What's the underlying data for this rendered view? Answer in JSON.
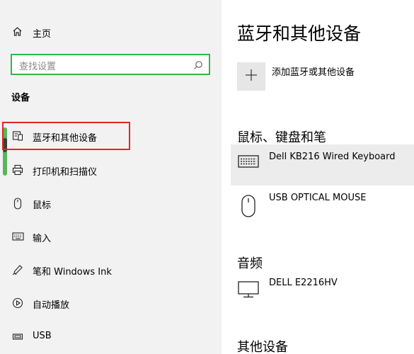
{
  "sidebar": {
    "home_label": "主页",
    "search_placeholder": "查找设置",
    "section_title": "设备",
    "items": [
      {
        "label": "蓝牙和其他设备",
        "icon": "bluetooth-devices-icon"
      },
      {
        "label": "打印机和扫描仪",
        "icon": "printer-icon"
      },
      {
        "label": "鼠标",
        "icon": "mouse-icon"
      },
      {
        "label": "输入",
        "icon": "keyboard-icon"
      },
      {
        "label": "笔和 Windows Ink",
        "icon": "pen-icon"
      },
      {
        "label": "自动播放",
        "icon": "autoplay-icon"
      },
      {
        "label": "USB",
        "icon": "usb-icon"
      }
    ]
  },
  "main": {
    "title": "蓝牙和其他设备",
    "add_label": "添加蓝牙或其他设备",
    "groups": [
      {
        "title": "鼠标、键盘和笔",
        "devices": [
          {
            "name": "Dell KB216 Wired Keyboard",
            "icon": "keyboard-icon"
          },
          {
            "name": "USB OPTICAL MOUSE",
            "icon": "mouse-icon"
          }
        ]
      },
      {
        "title": "音频",
        "devices": [
          {
            "name": "DELL E2216HV",
            "icon": "monitor-icon"
          }
        ]
      },
      {
        "title": "其他设备",
        "devices": []
      }
    ]
  },
  "colors": {
    "search_border": "#2fb84a",
    "selected_outline": "#e0262c",
    "accent": "#58b55a"
  }
}
